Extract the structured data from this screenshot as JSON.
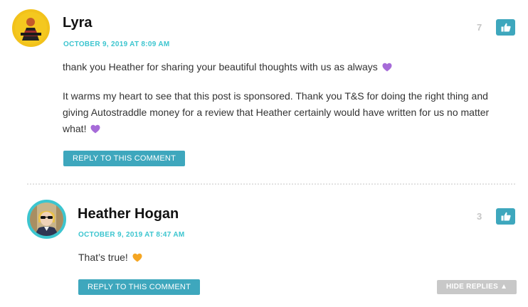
{
  "comments": [
    {
      "author": "Lyra",
      "date": "OCTOBER 9, 2019 AT 8:09 AM",
      "votes": "7",
      "paragraphs": [
        "thank you Heather for sharing your beautiful thoughts with us as always",
        "It warms my heart to see that this post is sponsored. Thank you T&S for doing the right thing and giving Autostraddle money for a review that Heather certainly would have written for us no matter what!"
      ],
      "reply_label": "REPLY TO THIS COMMENT",
      "heart_color": "#a66bd8"
    },
    {
      "author": "Heather Hogan",
      "date": "OCTOBER 9, 2019 AT 8:47 AM",
      "votes": "3",
      "paragraphs": [
        "That’s true!"
      ],
      "reply_label": "REPLY TO THIS COMMENT",
      "hide_replies_label": "HIDE REPLIES ▲",
      "heart_color": "#f5a623"
    }
  ],
  "colors": {
    "accent": "#3ea7bd",
    "date": "#3cc5cf",
    "avatar_ring_1": "#f2c21b",
    "avatar_ring_2": "#3cc5cf"
  },
  "icons": {
    "like": "thumbs-up-icon",
    "heart": "heart-icon"
  }
}
